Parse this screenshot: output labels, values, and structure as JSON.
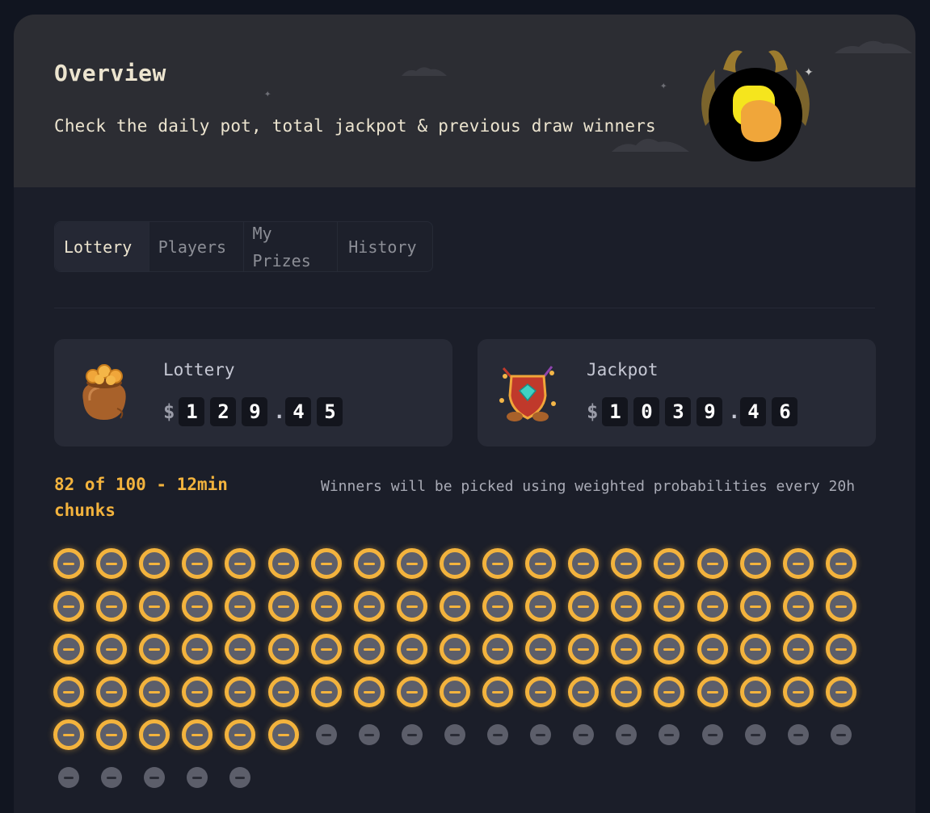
{
  "header": {
    "title": "Overview",
    "subtitle": "Check the daily pot, total jackpot & previous draw winners"
  },
  "tabs": [
    {
      "label": "Lottery",
      "active": true
    },
    {
      "label": "Players",
      "active": false
    },
    {
      "label": "My Prizes",
      "active": false
    },
    {
      "label": "History",
      "active": false
    }
  ],
  "lottery": {
    "label": "Lottery",
    "currency": "$",
    "digits": [
      "1",
      "2",
      "9",
      ".",
      "4",
      "5"
    ]
  },
  "jackpot": {
    "label": "Jackpot",
    "currency": "$",
    "digits": [
      "1",
      "0",
      "3",
      "9",
      ".",
      "4",
      "6"
    ]
  },
  "chunks": {
    "summary": "82 of 100 - 12min chunks",
    "note": "Winners will be picked using weighted probabilities every 20h",
    "filled": 82,
    "total": 100,
    "accent_color": "#f3b33d"
  },
  "icons": {
    "logo": "brand-logo-icon",
    "lottery": "coin-bag-icon",
    "jackpot": "shield-gem-icon"
  }
}
